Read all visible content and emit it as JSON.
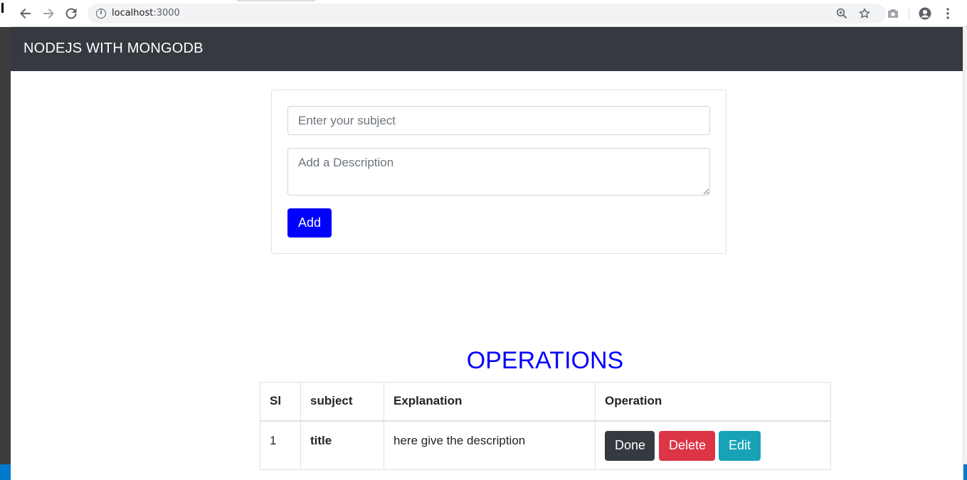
{
  "browser": {
    "url_host": "localhost",
    "url_port": ":3000"
  },
  "navbar": {
    "brand": "NODEJS WITH MONGODB"
  },
  "form": {
    "subject_placeholder": "Enter your subject",
    "subject_value": "",
    "description_placeholder": "Add a Description",
    "description_value": "",
    "add_label": "Add"
  },
  "operations": {
    "title": "OPERATIONS",
    "columns": [
      "Sl",
      "subject",
      "Explanation",
      "Operation"
    ],
    "rows": [
      {
        "sl": "1",
        "subject": "title",
        "explanation": "here give the description",
        "done_label": "Done",
        "delete_label": "Delete",
        "edit_label": "Edit"
      }
    ]
  },
  "colors": {
    "navbar_bg": "#343a40",
    "primary_blue": "#0000ff",
    "done": "#343a40",
    "delete": "#dc3545",
    "edit": "#17a2b8"
  },
  "icons": [
    "back-arrow-icon",
    "forward-arrow-icon",
    "reload-icon",
    "info-icon",
    "zoom-icon",
    "star-icon",
    "camera-icon",
    "account-icon",
    "menu-dots-icon"
  ]
}
